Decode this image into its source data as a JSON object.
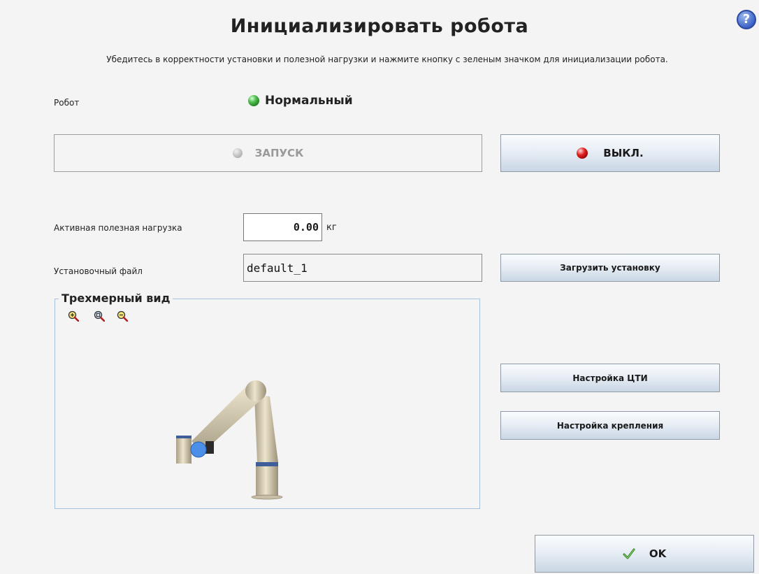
{
  "header": {
    "title": "Инициализировать робота",
    "subtitle": "Убедитесь в корректности установки и полезной нагрузки и нажмите кнопку с зеленым значком для инициализации робота.",
    "help_label": "?"
  },
  "robot": {
    "label": "Робот",
    "status": "Нормальный",
    "status_color": "#2e9b2e"
  },
  "controls": {
    "start_label": "ЗАПУСК",
    "off_label": "ВЫКЛ."
  },
  "payload": {
    "label": "Активная полезная нагрузка",
    "value": "0.00",
    "unit": "кг"
  },
  "installation": {
    "label": "Установочный файл",
    "value": "default_1",
    "load_button": "Загрузить установку"
  },
  "view3d": {
    "title": "Трехмерный вид",
    "zoom_icons": [
      "zoom-in-icon",
      "zoom-reset-icon",
      "zoom-out-icon"
    ]
  },
  "side_buttons": {
    "tcp": "Настройка ЦТИ",
    "mounting": "Настройка крепления"
  },
  "footer": {
    "ok_label": "OK"
  }
}
